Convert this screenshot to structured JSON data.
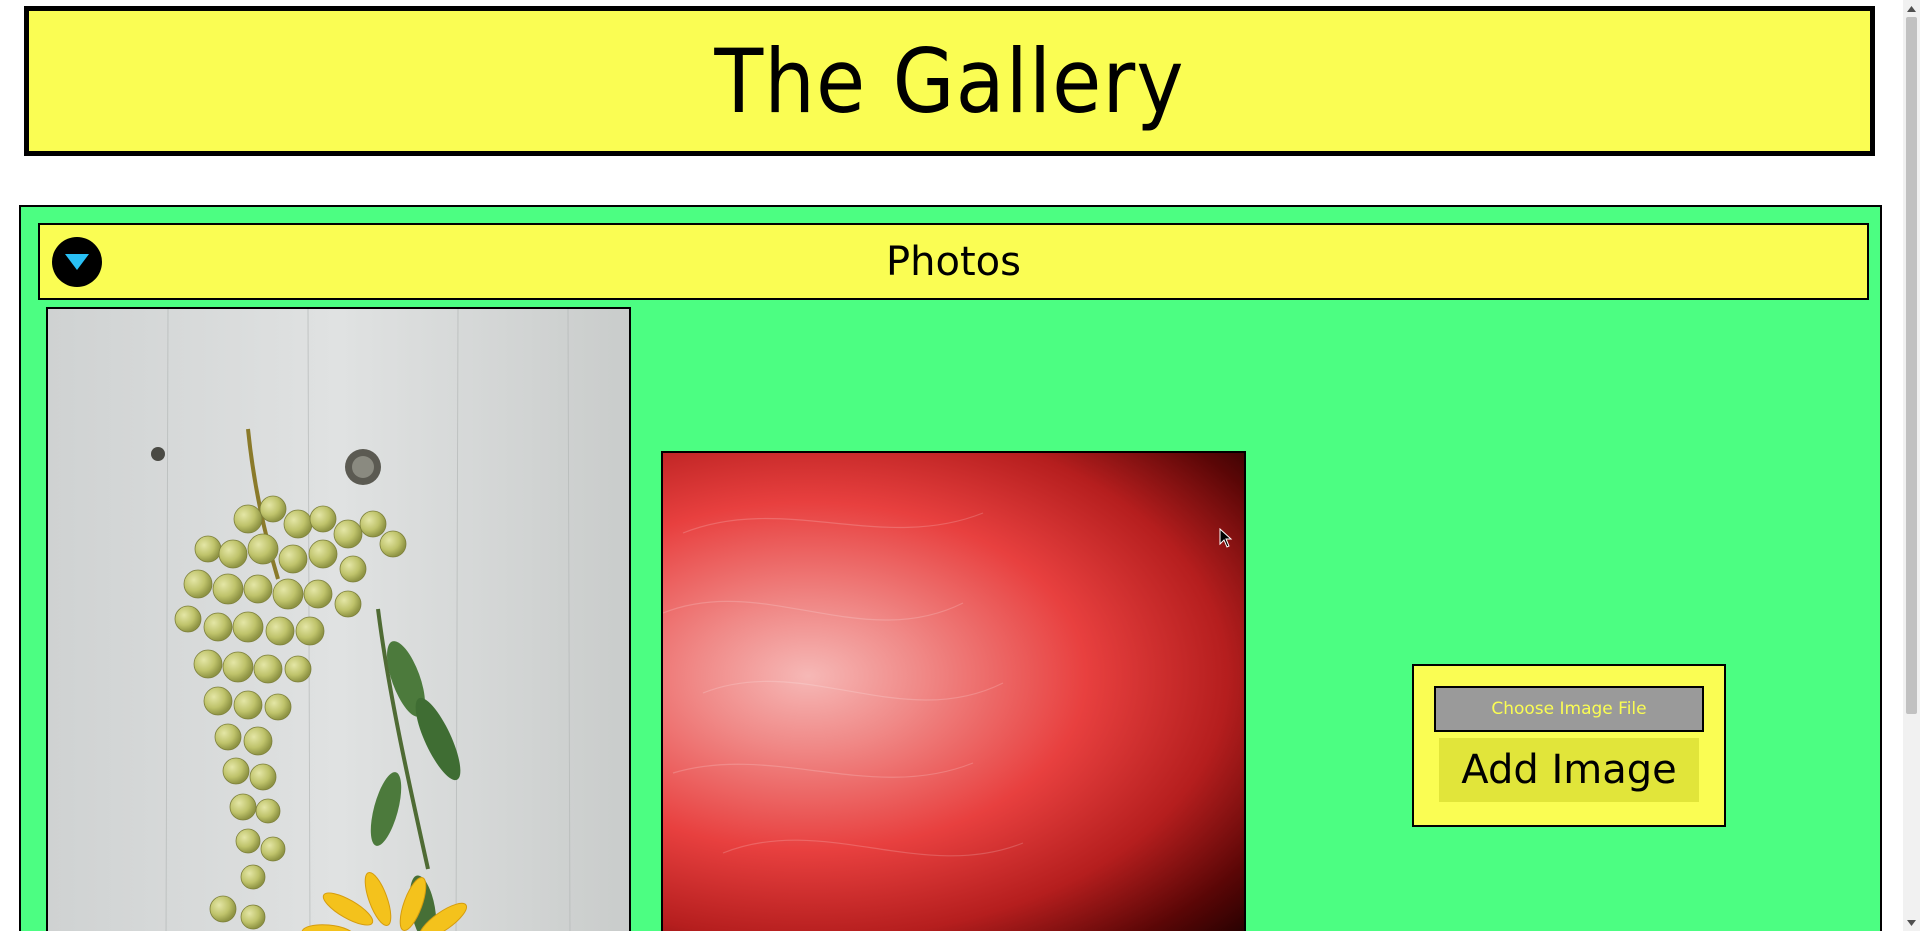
{
  "header": {
    "title": "The Gallery"
  },
  "section": {
    "title": "Photos",
    "toggle_icon": "chevron-down-icon"
  },
  "photos": [
    {
      "name": "grapes-photo"
    },
    {
      "name": "red-abstract-photo"
    }
  ],
  "upload": {
    "choose_label": "Choose Image File",
    "add_label": "Add Image"
  },
  "colors": {
    "header_bg": "#fafd53",
    "panel_bg": "#4cfe82",
    "toggle_arrow": "#29c0f5",
    "file_btn_bg": "#9a9a9a",
    "add_btn_bg": "#e1e53a"
  }
}
